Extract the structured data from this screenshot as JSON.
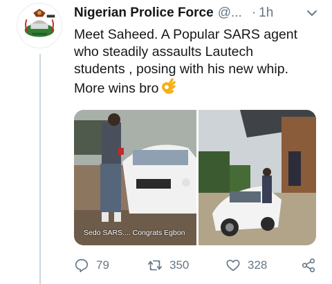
{
  "tweet": {
    "display_name": "Nigerian Prolice Force",
    "handle": "@...",
    "separator": "·",
    "time": "1h",
    "text_lines": [
      "Meet Saheed. A Popular SARS agent",
      "who steadily assaults Lautech",
      "students , posing with his new whip.",
      "More wins bro"
    ],
    "emoji": "ok-hand-emoji",
    "media": {
      "left_caption": "Sedo SARS.... Congrats Egbon"
    },
    "stats": {
      "replies": "79",
      "retweets": "350",
      "likes": "328"
    }
  },
  "icons": {
    "avatar": "police-crest-icon",
    "menu": "chevron-down-icon",
    "reply": "reply-icon",
    "retweet": "retweet-icon",
    "like": "heart-icon",
    "share": "share-icon"
  },
  "colors": {
    "text": "#14171a",
    "muted": "#657786",
    "thread_line": "#ccd6dd"
  }
}
